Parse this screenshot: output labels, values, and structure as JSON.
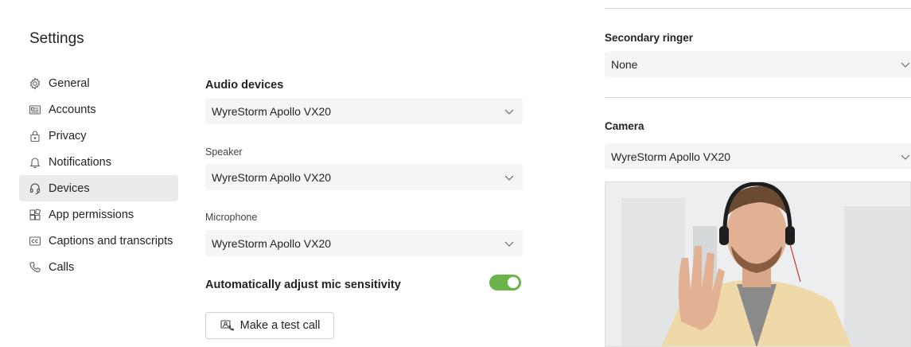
{
  "page": {
    "title": "Settings"
  },
  "nav": {
    "items": [
      {
        "label": "General",
        "icon": "gear-icon"
      },
      {
        "label": "Accounts",
        "icon": "id-card-icon"
      },
      {
        "label": "Privacy",
        "icon": "lock-icon"
      },
      {
        "label": "Notifications",
        "icon": "bell-icon"
      },
      {
        "label": "Devices",
        "icon": "headset-icon",
        "active": true
      },
      {
        "label": "App permissions",
        "icon": "apps-icon"
      },
      {
        "label": "Captions and transcripts",
        "icon": "cc-icon"
      },
      {
        "label": "Calls",
        "icon": "phone-icon"
      }
    ]
  },
  "audio": {
    "heading": "Audio devices",
    "audio_device": "WyreStorm Apollo VX20",
    "speaker_label": "Speaker",
    "speaker": "WyreStorm Apollo VX20",
    "microphone_label": "Microphone",
    "microphone": "WyreStorm Apollo VX20",
    "auto_adjust_label": "Automatically adjust mic sensitivity",
    "auto_adjust_on": true,
    "test_call_label": "Make a test call"
  },
  "right": {
    "secondary_ringer_heading": "Secondary ringer",
    "secondary_ringer": "None",
    "camera_heading": "Camera",
    "camera": "WyreStorm Apollo VX20"
  },
  "colors": {
    "toggle_on": "#6bb44b",
    "selected_nav": "#ebebeb",
    "dropdown_bg": "#f5f5f5"
  }
}
